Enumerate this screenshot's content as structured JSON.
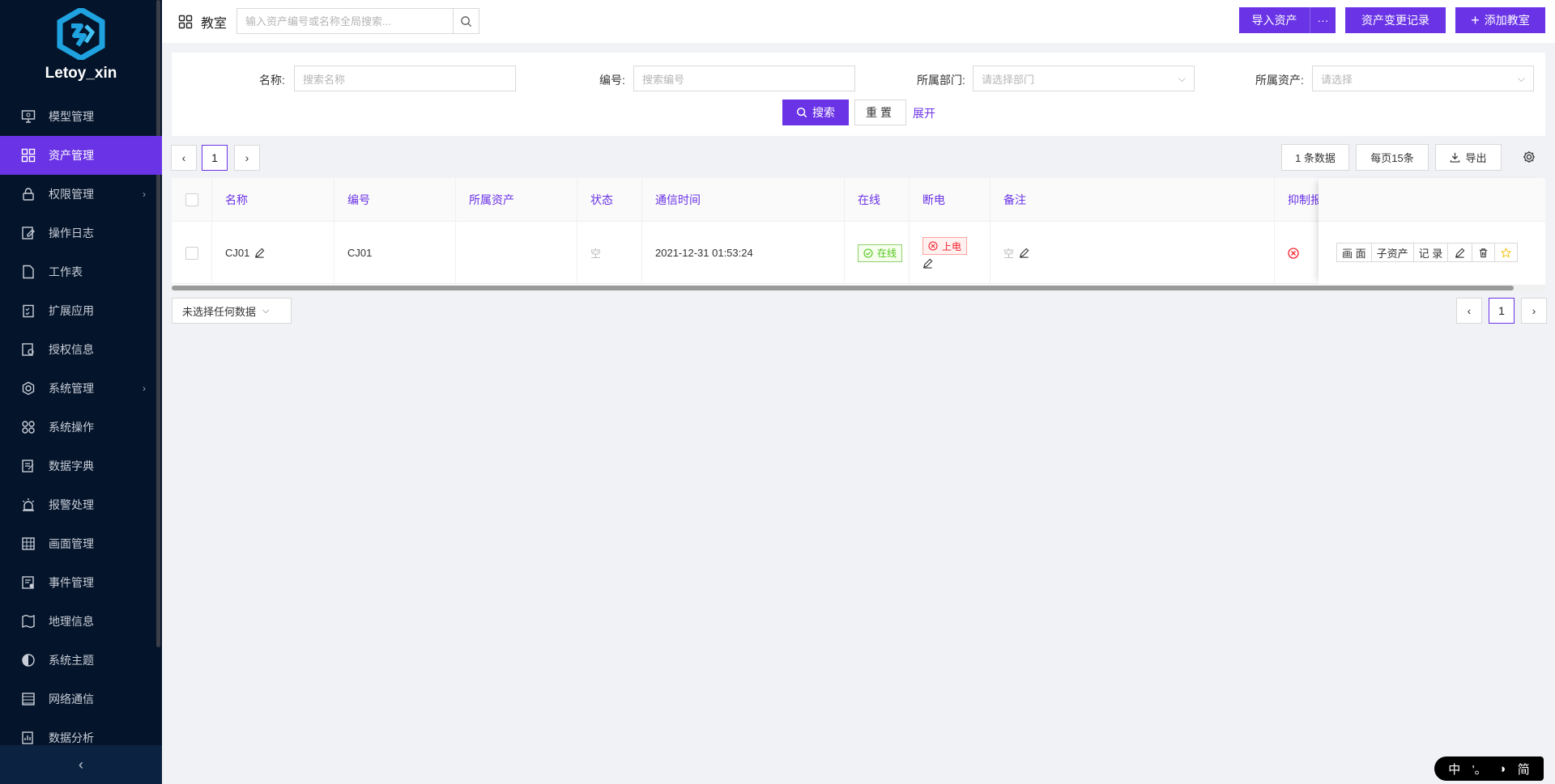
{
  "sidebar": {
    "brand": "Letoy_xin",
    "items": [
      {
        "label": "模型管理",
        "icon": "monitor-icon",
        "has_arrow": false
      },
      {
        "label": "资产管理",
        "icon": "grid-icon",
        "has_arrow": false,
        "active": true
      },
      {
        "label": "权限管理",
        "icon": "lock-icon",
        "has_arrow": true
      },
      {
        "label": "操作日志",
        "icon": "edit-doc-icon",
        "has_arrow": false
      },
      {
        "label": "工作表",
        "icon": "file-icon",
        "has_arrow": false
      },
      {
        "label": "扩展应用",
        "icon": "checklist-icon",
        "has_arrow": false
      },
      {
        "label": "授权信息",
        "icon": "license-icon",
        "has_arrow": false
      },
      {
        "label": "系统管理",
        "icon": "gear-icon",
        "has_arrow": true
      },
      {
        "label": "系统操作",
        "icon": "apps-icon",
        "has_arrow": false
      },
      {
        "label": "数据字典",
        "icon": "dictionary-icon",
        "has_arrow": false
      },
      {
        "label": "报警处理",
        "icon": "alarm-icon",
        "has_arrow": false
      },
      {
        "label": "画面管理",
        "icon": "canvas-icon",
        "has_arrow": false
      },
      {
        "label": "事件管理",
        "icon": "event-icon",
        "has_arrow": false
      },
      {
        "label": "地理信息",
        "icon": "map-icon",
        "has_arrow": false
      },
      {
        "label": "系统主题",
        "icon": "theme-icon",
        "has_arrow": false
      },
      {
        "label": "网络通信",
        "icon": "network-icon",
        "has_arrow": false
      },
      {
        "label": "数据分析",
        "icon": "analysis-icon",
        "has_arrow": false
      }
    ],
    "collapse_glyph": "‹"
  },
  "header": {
    "title": "教室",
    "search_placeholder": "输入资产编号或名称全局搜索...",
    "import_label": "导入资产",
    "more_label": "···",
    "history_label": "资产变更记录",
    "add_label": "添加教室",
    "add_glyph": "+"
  },
  "filters": {
    "name_label": "名称:",
    "name_placeholder": "搜索名称",
    "code_label": "编号:",
    "code_placeholder": "搜索编号",
    "dept_label": "所属部门:",
    "dept_placeholder": "请选择部门",
    "asset_label": "所属资产:",
    "asset_placeholder": "请选择",
    "search_label": "搜索",
    "reset_label": "重置",
    "expand_label": "展开"
  },
  "toolbar": {
    "prev_glyph": "‹",
    "next_glyph": "›",
    "page": "1",
    "count_label": "1 条数据",
    "per_page_label": "每页15条",
    "export_label": "导出"
  },
  "table": {
    "columns": [
      "名称",
      "编号",
      "所属资产",
      "状态",
      "通信时间",
      "在线",
      "断电",
      "备注",
      "抑制报"
    ],
    "rows": [
      {
        "name": "CJ01",
        "code": "CJ01",
        "asset": "",
        "status": "空",
        "comm_time": "2021-12-31 01:53:24",
        "online": "在线",
        "power": "上电",
        "remark": "空"
      }
    ],
    "ops": [
      "画 面",
      "子资产",
      "记 录"
    ]
  },
  "footer": {
    "selection_label": "未选择任何数据",
    "page": "1"
  },
  "ime": {
    "mode": "中",
    "punct": "'。",
    "width": "◑",
    "script": "简"
  },
  "colors": {
    "primary": "#6a33e6",
    "sidebar_bg": "#04142a",
    "online_green": "#52c41a",
    "power_red": "#f5222d"
  }
}
